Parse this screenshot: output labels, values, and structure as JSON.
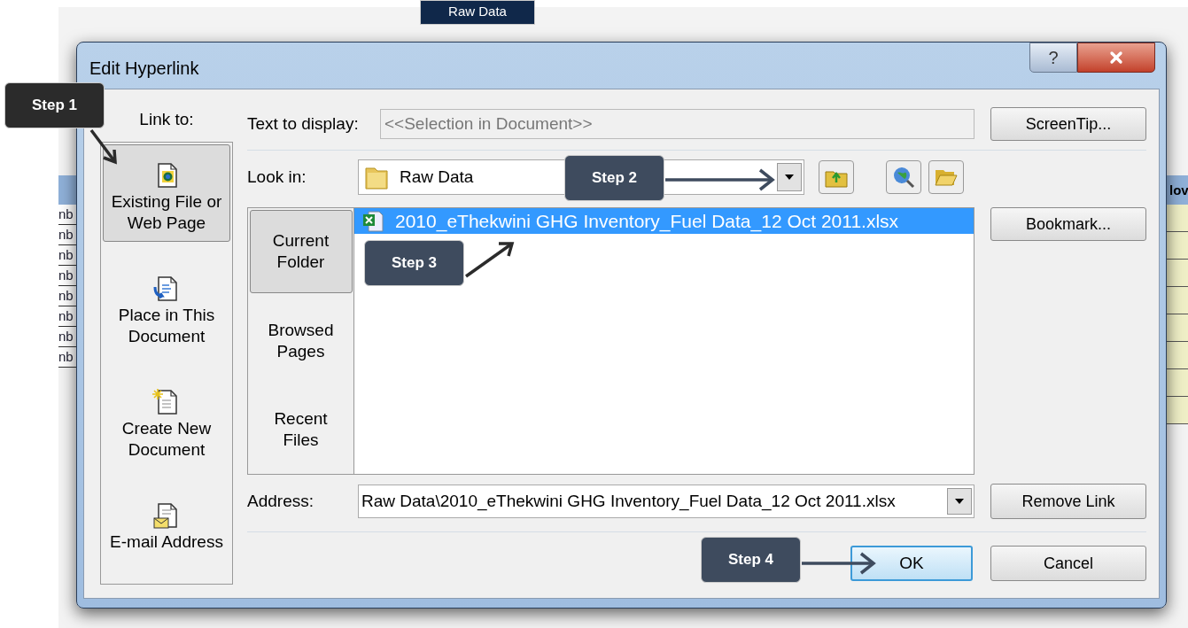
{
  "background": {
    "shape_label": "Raw Data",
    "header_fragment": "lov",
    "row_fragments": [
      "nb",
      "nb",
      "nb",
      "nb",
      "nb",
      "nb",
      "nb",
      "nb"
    ]
  },
  "dialog": {
    "title": "Edit Hyperlink",
    "help_button": "?",
    "link_to": {
      "label": "Link to:",
      "items": [
        {
          "label": "Existing File or\nWeb Page",
          "selected": true,
          "kind": "file"
        },
        {
          "label": "Place in This\nDocument",
          "selected": false,
          "kind": "place"
        },
        {
          "label": "Create New\nDocument",
          "selected": false,
          "kind": "new"
        },
        {
          "label": "E-mail Address",
          "selected": false,
          "kind": "email"
        }
      ]
    },
    "text_to_display": {
      "label": "Text to display:",
      "value": "<<Selection in Document>>",
      "disabled": true
    },
    "look_in": {
      "label": "Look in:",
      "value": "Raw Data"
    },
    "nav": [
      {
        "label": "Current\nFolder",
        "selected": true
      },
      {
        "label": "Browsed\nPages",
        "selected": false
      },
      {
        "label": "Recent\nFiles",
        "selected": false
      }
    ],
    "files": [
      {
        "name": "2010_eThekwini GHG Inventory_Fuel Data_12 Oct 2011.xlsx",
        "selected": true
      }
    ],
    "address": {
      "label": "Address:",
      "value": "Raw Data\\2010_eThekwini GHG Inventory_Fuel Data_12 Oct 2011.xlsx"
    },
    "buttons": {
      "screentip": "ScreenTip...",
      "bookmark": "Bookmark...",
      "remove_link": "Remove Link",
      "ok": "OK",
      "cancel": "Cancel"
    }
  },
  "callouts": [
    {
      "label": "Step 1",
      "color": "#2b2b2b"
    },
    {
      "label": "Step 2",
      "color": "#3e4b5e"
    },
    {
      "label": "Step 3",
      "color": "#3e4b5e"
    },
    {
      "label": "Step 4",
      "color": "#3e4b5e"
    }
  ]
}
